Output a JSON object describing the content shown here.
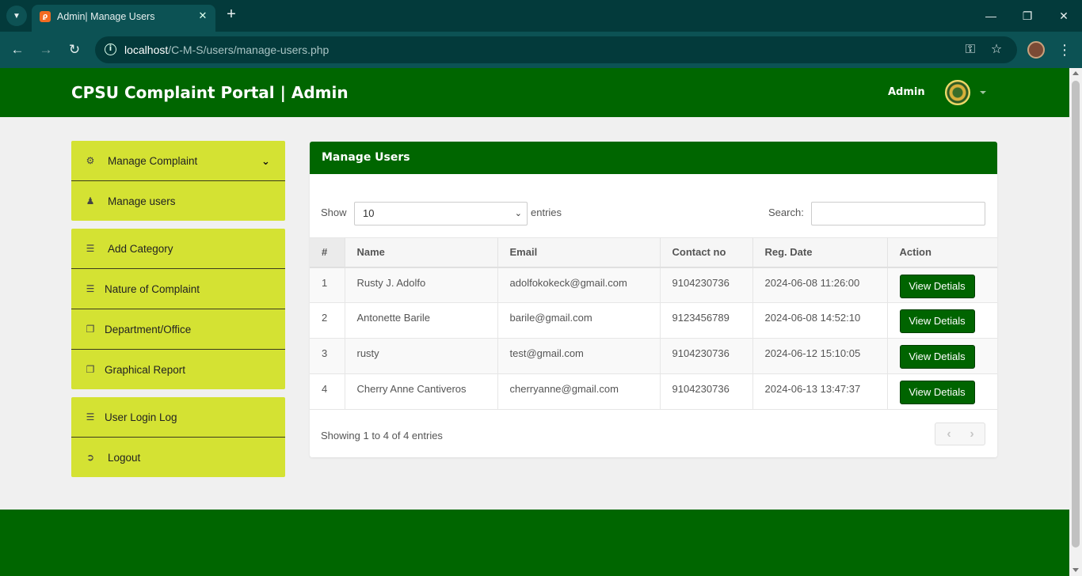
{
  "browser": {
    "tab_title": "Admin| Manage Users",
    "url_host": "localhost",
    "url_path": "/C-M-S/users/manage-users.php"
  },
  "header": {
    "brand": "CPSU Complaint Portal | Admin",
    "admin_name": "Admin"
  },
  "sidebar": {
    "groups": [
      {
        "items": [
          {
            "label": "Manage Complaint",
            "icon": "gear-icon"
          },
          {
            "label": "Manage users",
            "icon": "users-icon"
          }
        ]
      },
      {
        "items": [
          {
            "label": "Add Category",
            "icon": "list-icon"
          },
          {
            "label": "Nature of Complaint",
            "icon": "list-icon"
          },
          {
            "label": "Department/Office",
            "icon": "copy-icon"
          },
          {
            "label": "Graphical Report",
            "icon": "copy-icon"
          }
        ]
      },
      {
        "items": [
          {
            "label": "User Login Log",
            "icon": "list-icon"
          },
          {
            "label": "Logout",
            "icon": "sign-out-icon"
          }
        ]
      }
    ]
  },
  "panel": {
    "title": "Manage Users",
    "show_label": "Show",
    "length_value": "10",
    "entries_label": "entries",
    "search_label": "Search:",
    "search_value": "",
    "columns": [
      "#",
      "Name",
      "Email",
      "Contact no",
      "Reg. Date",
      "Action"
    ],
    "rows": [
      {
        "num": "1",
        "name": "Rusty J. Adolfo",
        "email": "adolfokokeck@gmail.com",
        "contact": "9104230736",
        "reg_date": "2024-06-08 11:26:00",
        "action": "View Detials"
      },
      {
        "num": "2",
        "name": "Antonette Barile",
        "email": "barile@gmail.com",
        "contact": "9123456789",
        "reg_date": "2024-06-08 14:52:10",
        "action": "View Detials"
      },
      {
        "num": "3",
        "name": "rusty",
        "email": "test@gmail.com",
        "contact": "9104230736",
        "reg_date": "2024-06-12 15:10:05",
        "action": "View Detials"
      },
      {
        "num": "4",
        "name": "Cherry Anne Cantiveros",
        "email": "cherryanne@gmail.com",
        "contact": "9104230736",
        "reg_date": "2024-06-13 13:47:37",
        "action": "View Detials"
      }
    ],
    "info": "Showing 1 to 4 of 4 entries"
  },
  "colors": {
    "brand_green": "#006600",
    "sidebar_lime": "#d4e233",
    "button_green": "#006400"
  }
}
